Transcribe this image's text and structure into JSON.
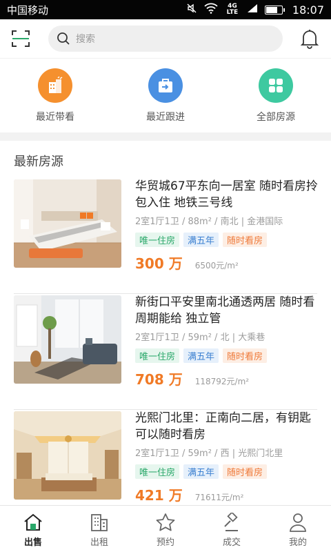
{
  "status_bar": {
    "carrier": "中国移动",
    "network": "4G LTE",
    "time": "18:07",
    "battery_level": 0.75
  },
  "header": {
    "search_placeholder": "搜索"
  },
  "shortcuts": [
    {
      "label": "最近带看",
      "icon": "building-icon",
      "color": "#f5902e"
    },
    {
      "label": "最近跟进",
      "icon": "briefcase-arrow-icon",
      "color": "#4a90e2"
    },
    {
      "label": "全部房源",
      "icon": "grid-icon",
      "color": "#3ec9a0"
    }
  ],
  "section_title": "最新房源",
  "listings": [
    {
      "title": "华贸城67平东向一居室 随时看房拎包入住 地铁三号线",
      "layout": "2室1厅1卫",
      "area": "88m²",
      "orientation": "南北",
      "community": "金港国际",
      "tags": [
        "唯一住房",
        "满五年",
        "随时看房"
      ],
      "price": "300 万",
      "unit_price": "6500元/m²"
    },
    {
      "title": "新街口平安里南北通透两居 随时看 周期能给 独立管",
      "layout": "2室1厅1卫",
      "area": "59m²",
      "orientation": "北",
      "community": "大乘巷",
      "tags": [
        "唯一住房",
        "满五年",
        "随时看房"
      ],
      "price": "708 万",
      "unit_price": "118792元/m²"
    },
    {
      "title": "光熙门北里：正南向二居，有钥匙可以随时看房",
      "layout": "2室1厅1卫",
      "area": "59m²",
      "orientation": "西",
      "community": "光熙门北里",
      "tags": [
        "唯一住房",
        "满五年",
        "随时看房"
      ],
      "price": "421 万",
      "unit_price": "71611元/m²"
    }
  ],
  "tabbar": [
    {
      "label": "出售",
      "icon": "house-icon",
      "active": true
    },
    {
      "label": "出租",
      "icon": "apartment-building-icon",
      "active": false
    },
    {
      "label": "预约",
      "icon": "star-icon",
      "active": false
    },
    {
      "label": "成交",
      "icon": "gavel-icon",
      "active": false
    },
    {
      "label": "我的",
      "icon": "person-icon",
      "active": false
    }
  ],
  "colors": {
    "accent_green": "#2aa86a",
    "price_orange": "#f07a26"
  }
}
